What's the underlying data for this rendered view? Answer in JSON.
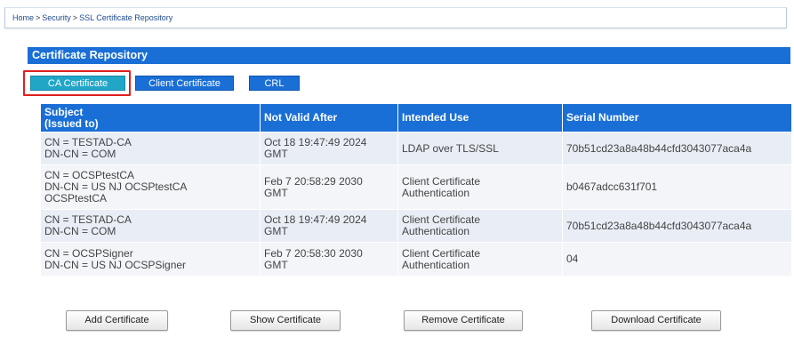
{
  "breadcrumb": {
    "items": [
      "Home",
      "Security",
      "SSL Certificate Repository"
    ],
    "separator": ">"
  },
  "panel": {
    "title": "Certificate Repository"
  },
  "tabs": [
    {
      "label": "CA Certificate",
      "active": true
    },
    {
      "label": "Client Certificate",
      "active": false
    },
    {
      "label": "CRL",
      "active": false
    }
  ],
  "table": {
    "columns": [
      "Subject\n(Issued to)",
      "Not Valid After",
      "Intended Use",
      "Serial Number"
    ],
    "rows": [
      {
        "subject": "CN = TESTAD-CA\nDN-CN = COM",
        "not_valid_after": "Oct 18 19:47:49 2024\nGMT",
        "intended_use": "LDAP over TLS/SSL",
        "serial": "70b51cd23a8a48b44cfd3043077aca4a"
      },
      {
        "subject": "CN = OCSPtestCA\nDN-CN = US NJ OCSPtestCA\nOCSPtestCA",
        "not_valid_after": "Feb 7 20:58:29 2030\nGMT",
        "intended_use": "Client Certificate\nAuthentication",
        "serial": "b0467adcc631f701"
      },
      {
        "subject": "CN = TESTAD-CA\nDN-CN = COM",
        "not_valid_after": "Oct 18 19:47:49 2024\nGMT",
        "intended_use": "Client Certificate\nAuthentication",
        "serial": "70b51cd23a8a48b44cfd3043077aca4a"
      },
      {
        "subject": "CN = OCSPSigner\nDN-CN = US NJ OCSPSigner",
        "not_valid_after": "Feb 7 20:58:30 2030\nGMT",
        "intended_use": "Client Certificate\nAuthentication",
        "serial": "04"
      }
    ]
  },
  "buttons": {
    "add": "Add Certificate",
    "show": "Show Certificate",
    "remove": "Remove Certificate",
    "download": "Download Certificate"
  },
  "colors": {
    "accent": "#1a6fd6",
    "active_tab": "#22a6c7",
    "highlight": "#e02020",
    "row_bg": "#e9eef6"
  }
}
